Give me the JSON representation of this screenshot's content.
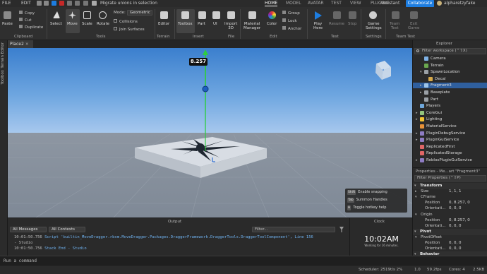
{
  "titlebar": {
    "app_name": "FILE",
    "edit_label": "EDIT",
    "migrate_label": "Migrate unions in selection",
    "assistant_label": "Assistant",
    "user_label": "alpharetzyfake",
    "collaborate_label": "Collaborate",
    "tabs": [
      "HOME",
      "MODEL",
      "AVATAR",
      "TEST",
      "VIEW",
      "PLUGINS"
    ]
  },
  "ribbon": {
    "paste": "Paste",
    "copy": "Copy",
    "cut": "Cut",
    "duplicate": "Duplicate",
    "clipboard_group": "Clipboard",
    "select": "Select",
    "move": "Move",
    "scale": "Scale",
    "rotate": "Rotate",
    "tools_group": "Tools",
    "mode_label": "Mode:",
    "mode_value": "Geometric",
    "collisions": "Collisions",
    "join_surfaces": "Join Surfaces",
    "editor": "Editor",
    "terrain_group": "Terrain",
    "toolbox": "Toolbox",
    "part": "Part",
    "ui": "UI",
    "import3d": "Import\n3D",
    "insert_group": "Insert",
    "file_group": "File",
    "material_manager": "Material\nManager",
    "color": "Color",
    "group": "Group",
    "lock": "Lock",
    "anchor": "Anchor",
    "edit_group": "Edit",
    "play": "Play\nHere",
    "resume": "Resume",
    "stop": "Stop",
    "test_group": "Test",
    "game_settings": "Game\nSettings",
    "settings_group": "Settings",
    "team_test": "Team\nTest",
    "exit_game": "Exit\nGame",
    "team_test_group": "Team Test"
  },
  "leftstrip": {
    "terrain_editor": "Terrain Editor",
    "toolbox": "Toolbox"
  },
  "viewport": {
    "tab_label": "Place2",
    "measure_value": "8.257",
    "hints": [
      {
        "key": "Shift",
        "label": "Enable snapping"
      },
      {
        "key": "Tab",
        "label": "Summon Handles"
      },
      {
        "key": "H",
        "label": "Toggle hotkey help"
      }
    ]
  },
  "output": {
    "title": "Output",
    "filter_messages": "All Messages",
    "filter_contexts": "All Contexts",
    "filter_placeholder": "Filter...",
    "lines": [
      {
        "time": "10:01:50.756",
        "text": "Script 'builtin_MoveDragger.rbxm.MoveDragger.Packages.DraggerFramework.DraggerTools.DraggerToolComponent', Line 156"
      },
      {
        "time": "",
        "text": "- Studio"
      },
      {
        "time": "10:01:50.756",
        "text": "Stack End  -  Studio"
      }
    ]
  },
  "clock": {
    "title": "Clock",
    "time": "10:02AM",
    "subtitle": "Working for 16 minutes."
  },
  "explorer": {
    "title": "Explorer",
    "filter_placeholder": "Filter workspace (⌃⇧X)",
    "items": [
      {
        "label": "Camera",
        "indent": 2,
        "icon": "camera-icon",
        "color": "#7fb2e6",
        "arrow": ""
      },
      {
        "label": "Terrain",
        "indent": 2,
        "icon": "terrain-icon",
        "color": "#6aa84f",
        "arrow": ""
      },
      {
        "label": "SpawnLocation",
        "indent": 2,
        "icon": "spawn-icon",
        "color": "#9aa0a6",
        "arrow": "▾"
      },
      {
        "label": "Decal",
        "indent": 3,
        "icon": "decal-icon",
        "color": "#d6a94a",
        "arrow": ""
      },
      {
        "label": "Fragment3",
        "indent": 2,
        "icon": "model-icon",
        "color": "#9fc5e8",
        "arrow": "▸",
        "selected": true
      },
      {
        "label": "Baseplate",
        "indent": 2,
        "icon": "part-icon",
        "color": "#9aa0a6",
        "arrow": "▸"
      },
      {
        "label": "Part",
        "indent": 2,
        "icon": "part-icon",
        "color": "#9aa0a6",
        "arrow": ""
      },
      {
        "label": "Players",
        "indent": 1,
        "icon": "players-icon",
        "color": "#6fa8dc",
        "arrow": ""
      },
      {
        "label": "CoreGui",
        "indent": 1,
        "icon": "coregui-icon",
        "color": "#93c47d",
        "arrow": "▸"
      },
      {
        "label": "Lighting",
        "indent": 1,
        "icon": "lighting-icon",
        "color": "#f1c232",
        "arrow": "▸"
      },
      {
        "label": "MaterialService",
        "indent": 1,
        "icon": "material-icon",
        "color": "#e69138",
        "arrow": ""
      },
      {
        "label": "PluginDebugService",
        "indent": 1,
        "icon": "plugin-icon",
        "color": "#8e7cc3",
        "arrow": "▸"
      },
      {
        "label": "PluginGuiService",
        "indent": 1,
        "icon": "plugin-icon",
        "color": "#8e7cc3",
        "arrow": "▸"
      },
      {
        "label": "ReplicatedFirst",
        "indent": 1,
        "icon": "replicated-icon",
        "color": "#e06666",
        "arrow": ""
      },
      {
        "label": "ReplicatedStorage",
        "indent": 1,
        "icon": "storage-icon",
        "color": "#e06666",
        "arrow": ""
      },
      {
        "label": "RobloxPluginGuiService",
        "indent": 1,
        "icon": "plugin-icon",
        "color": "#8e7cc3",
        "arrow": "▸"
      }
    ]
  },
  "properties": {
    "title": "Properties - Me...art \"Fragment3\"",
    "filter_placeholder": "Filter Properties (⌃⇧P)",
    "rows": [
      {
        "kind": "cat",
        "label": "Transform"
      },
      {
        "kind": "prop",
        "label": "Size",
        "value": "1, 1, 1",
        "indent": 1
      },
      {
        "kind": "prop",
        "label": "CFrame",
        "value": "",
        "indent": 1,
        "arrow": "▾"
      },
      {
        "kind": "prop",
        "label": "Position",
        "value": "0, 8.257, 0",
        "indent": 2
      },
      {
        "kind": "prop",
        "label": "Orientati...",
        "value": "0, 0, 0",
        "indent": 2
      },
      {
        "kind": "prop",
        "label": "Origin",
        "value": "",
        "indent": 1,
        "arrow": "▾"
      },
      {
        "kind": "prop",
        "label": "Position",
        "value": "0, 8.257, 0",
        "indent": 2
      },
      {
        "kind": "prop",
        "label": "Orientati...",
        "value": "0, 0, 0",
        "indent": 2
      },
      {
        "kind": "cat",
        "label": "Pivot"
      },
      {
        "kind": "prop",
        "label": "PivotOffset",
        "value": "",
        "indent": 1,
        "arrow": "▾"
      },
      {
        "kind": "prop",
        "label": "Position",
        "value": "0, 0, 0",
        "indent": 2
      },
      {
        "kind": "prop",
        "label": "Orientati...",
        "value": "0, 0, 0",
        "indent": 2
      },
      {
        "kind": "cat",
        "label": "Behavior"
      }
    ]
  },
  "commandbar": {
    "placeholder": "Run a command"
  },
  "status": {
    "scheduler": "Scheduler: 2519t/s 2%",
    "time": "1.0",
    "fps": "59.2fps",
    "cores": "Cores: 4",
    "mem": "2.5KB"
  },
  "colors": {
    "accent": "#1d7de0",
    "selection": "#2f5f9e",
    "gizmo_green": "#2ecc40",
    "gizmo_blue": "#1f5fbf"
  }
}
